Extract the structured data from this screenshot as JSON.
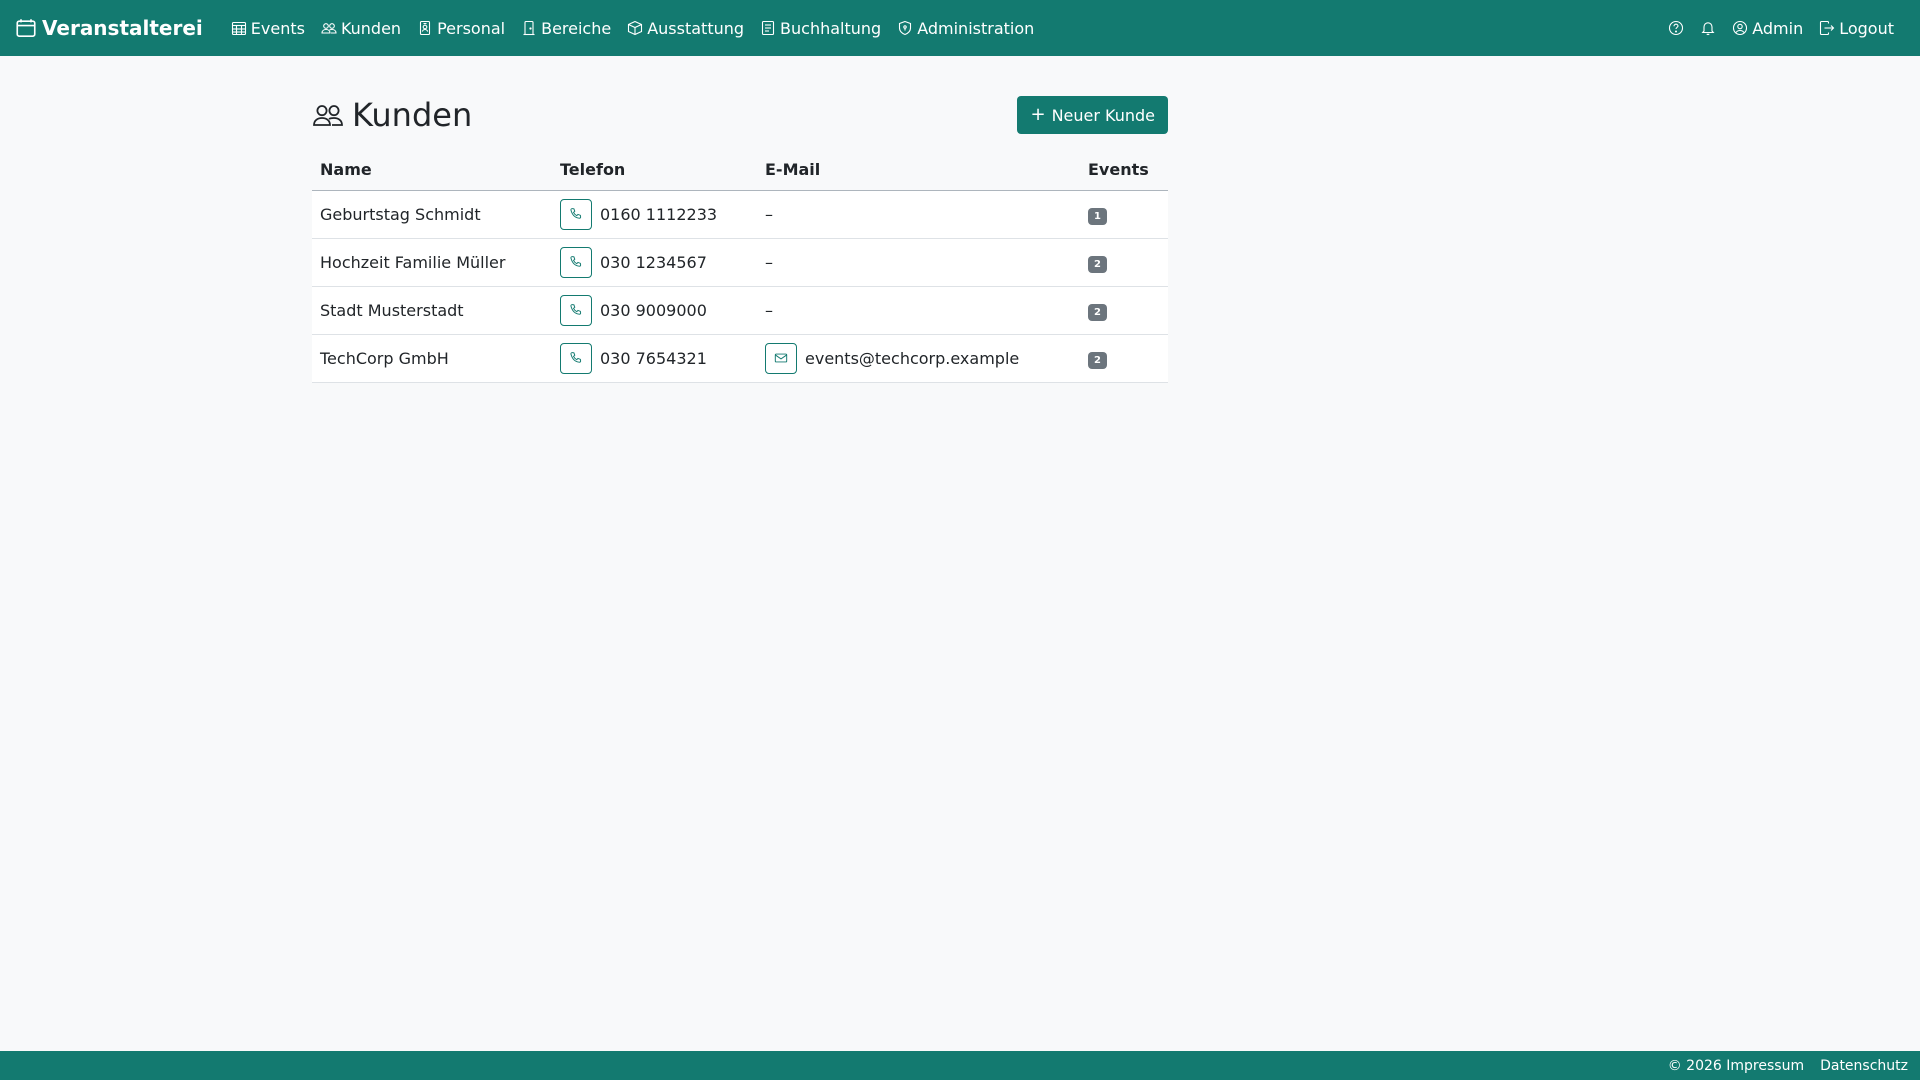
{
  "app": {
    "brand": "Veranstalterei"
  },
  "nav": {
    "items": [
      {
        "label": "Events",
        "icon": "calendar-grid-icon"
      },
      {
        "label": "Kunden",
        "icon": "people-icon"
      },
      {
        "label": "Personal",
        "icon": "badge-icon"
      },
      {
        "label": "Bereiche",
        "icon": "door-icon"
      },
      {
        "label": "Ausstattung",
        "icon": "box-icon"
      },
      {
        "label": "Buchhaltung",
        "icon": "journal-icon"
      },
      {
        "label": "Administration",
        "icon": "shield-icon"
      }
    ],
    "right": {
      "help_icon": "question-circle-icon",
      "bell_icon": "bell-icon",
      "user_label": "Admin",
      "logout_label": "Logout"
    }
  },
  "page": {
    "title": "Kunden",
    "new_button_label": "Neuer Kunde"
  },
  "table": {
    "headers": {
      "name": "Name",
      "phone": "Telefon",
      "email": "E-Mail",
      "events": "Events"
    },
    "rows": [
      {
        "name": "Geburtstag Schmidt",
        "phone": "0160 1112233",
        "email": "–",
        "has_email": false,
        "events": "1"
      },
      {
        "name": "Hochzeit Familie Müller",
        "phone": "030 1234567",
        "email": "–",
        "has_email": false,
        "events": "2"
      },
      {
        "name": "Stadt Musterstadt",
        "phone": "030 9009000",
        "email": "–",
        "has_email": false,
        "events": "2"
      },
      {
        "name": "TechCorp GmbH",
        "phone": "030 7654321",
        "email": "events@techcorp.example",
        "has_email": true,
        "events": "2"
      }
    ]
  },
  "footer": {
    "copyright": "© 2026 Impressum",
    "privacy": "Datenschutz"
  },
  "colors": {
    "primary": "#137a70",
    "background": "#f8f9fa",
    "badge": "#6c757d"
  }
}
